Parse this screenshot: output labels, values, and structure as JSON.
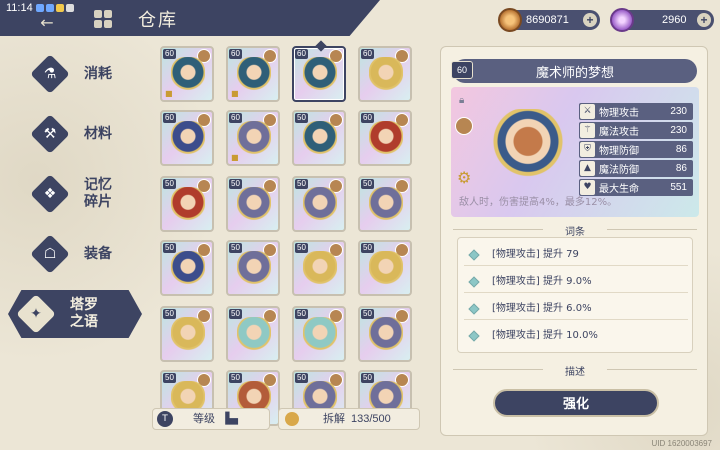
{
  "status_bar": {
    "time": "11:14"
  },
  "header": {
    "title": "仓库"
  },
  "currency": {
    "gold": {
      "value": "8690871"
    },
    "gem": {
      "value": "2960"
    }
  },
  "sidebar": {
    "items": [
      {
        "label": "消耗",
        "icon": "potion-icon"
      },
      {
        "label": "材料",
        "icon": "materials-icon"
      },
      {
        "label": "记忆\n碎片",
        "icon": "puzzle-icon"
      },
      {
        "label": "装备",
        "icon": "equipment-icon"
      },
      {
        "label": "塔罗\n之语",
        "icon": "tarot-icon",
        "active": true
      }
    ]
  },
  "grid": {
    "cards": [
      {
        "level": "60",
        "art": "#2f5f78",
        "locked": true
      },
      {
        "level": "60",
        "art": "#2f5f78",
        "locked": true
      },
      {
        "level": "60",
        "art": "#2f5f78",
        "locked": false,
        "selected": true
      },
      {
        "level": "60",
        "art": "#d9b85a",
        "locked": false
      },
      {
        "level": "60",
        "art": "#3c4d8c",
        "locked": false
      },
      {
        "level": "60",
        "art": "#6f6f9a",
        "locked": true
      },
      {
        "level": "50",
        "art": "#2f5f78",
        "locked": false
      },
      {
        "level": "60",
        "art": "#b03c2c",
        "locked": false
      },
      {
        "level": "50",
        "art": "#b03c2c",
        "locked": false
      },
      {
        "level": "50",
        "art": "#6f6f9a",
        "locked": false
      },
      {
        "level": "50",
        "art": "#6f6f9a",
        "locked": false
      },
      {
        "level": "50",
        "art": "#6f6f9a",
        "locked": false
      },
      {
        "level": "50",
        "art": "#3c4d8c",
        "locked": false
      },
      {
        "level": "50",
        "art": "#6f6f9a",
        "locked": false
      },
      {
        "level": "50",
        "art": "#d9b85a",
        "locked": false
      },
      {
        "level": "50",
        "art": "#d9b85a",
        "locked": false
      },
      {
        "level": "50",
        "art": "#d9b85a",
        "locked": false
      },
      {
        "level": "50",
        "art": "#8fc9c4",
        "locked": false
      },
      {
        "level": "50",
        "art": "#8fc9c4",
        "locked": false
      },
      {
        "level": "50",
        "art": "#6f6f9a",
        "locked": false
      },
      {
        "level": "50",
        "art": "#d9b85a",
        "locked": false
      },
      {
        "level": "50",
        "art": "#b35c3a",
        "locked": false
      },
      {
        "level": "50",
        "art": "#6f6f9a",
        "locked": false
      },
      {
        "level": "50",
        "art": "#6f6f9a",
        "locked": false
      }
    ]
  },
  "bottom": {
    "level_label": "等级",
    "disassemble_label": "拆解",
    "disassemble_count": "133/500"
  },
  "detail": {
    "level": "60",
    "name": "魔术师的梦想",
    "stats": [
      {
        "name": "物理攻击",
        "value": "230",
        "icon": "sword-icon"
      },
      {
        "name": "魔法攻击",
        "value": "230",
        "icon": "staff-icon"
      },
      {
        "name": "物理防御",
        "value": "86",
        "icon": "shield-icon"
      },
      {
        "name": "魔法防御",
        "value": "86",
        "icon": "hat-icon"
      },
      {
        "name": "最大生命",
        "value": "551",
        "icon": "heart-icon"
      }
    ],
    "description": "敌人时，伤害提高4%，最多12%。",
    "traits_label": "词条",
    "traits": [
      "[物理攻击] 提升 79",
      "[物理攻击] 提升 9.0%",
      "[物理攻击] 提升 6.0%",
      "[物理攻击] 提升 10.0%"
    ],
    "desc_label": "描述",
    "enhance_label": "强化"
  },
  "uid": "UID 1620003697"
}
